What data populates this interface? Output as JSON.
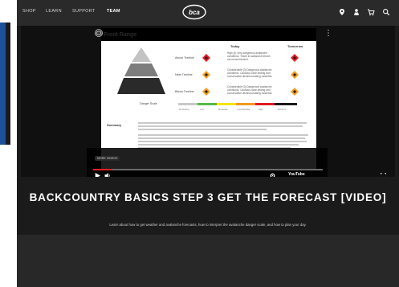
{
  "nav": {
    "items": [
      "SHOP",
      "LEARN",
      "SUPPORT",
      "TEAM"
    ],
    "logo_text": "bca"
  },
  "video": {
    "slide_title": "Front Range",
    "columns": [
      "Today",
      "Tomorrow"
    ],
    "rows": [
      {
        "label": "Above Treeline",
        "today": "High (4) Very dangerous avalanche conditions. Travel in avalanche terrain not recommended."
      },
      {
        "label": "Near Treeline",
        "today": "Considerable (3) Dangerous avalanche conditions. Cautious route-finding and conservative decision-making essential."
      },
      {
        "label": "Below Treeline",
        "today": "Considerable (3) Dangerous avalanche conditions. Cautious route-finding and conservative decision-making essential."
      }
    ],
    "danger_scale_label": "Danger Scale",
    "danger_levels": [
      "No Rating",
      "Low",
      "Moderate",
      "Considerable",
      "High",
      "Extreme"
    ],
    "danger_colors": [
      "#c8c8c8",
      "#57b947",
      "#f5e614",
      "#f39c1d",
      "#e31b23",
      "#1b1b1b"
    ],
    "summary_label": "Summary",
    "more_videos": "MORE VIDEOS",
    "youtube_label": "YouTube",
    "progress_fraction": 0.08
  },
  "content": {
    "title": "BACKCOUNTRY BASICS STEP 3 GET THE FORECAST [VIDEO]",
    "subtitle": "Learn about how to get weather and avalanche forecasts, how to interpret the avalanche danger scale, and how to plan your day."
  }
}
